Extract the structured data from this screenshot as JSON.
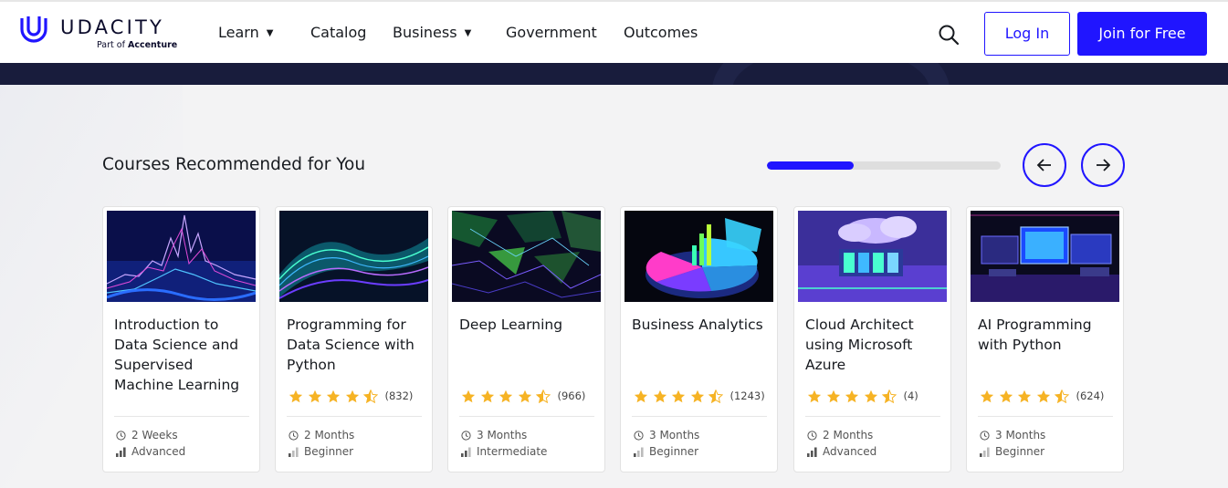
{
  "brand": {
    "name": "UDACITY",
    "subtitle_prefix": "Part of",
    "subtitle_company": "Accenture",
    "accent": "#2015ff"
  },
  "nav": {
    "items": [
      {
        "label": "Learn",
        "has_dropdown": true
      },
      {
        "label": "Catalog",
        "has_dropdown": false
      },
      {
        "label": "Business",
        "has_dropdown": true
      },
      {
        "label": "Government",
        "has_dropdown": false
      },
      {
        "label": "Outcomes",
        "has_dropdown": false
      }
    ],
    "search_icon": "search-icon",
    "login_label": "Log In",
    "join_label": "Join for Free"
  },
  "section": {
    "title": "Courses Recommended for You",
    "carousel_progress": 0.37,
    "prev_icon": "arrow-left-icon",
    "next_icon": "arrow-right-icon"
  },
  "cards": [
    {
      "title": "Introduction to Data Science and Supervised Machine Learning",
      "rating": null,
      "reviews": "",
      "duration": "2 Weeks",
      "level": "Advanced",
      "image": "data-peaks-image"
    },
    {
      "title": "Programming for Data Science with Python",
      "rating": 4.5,
      "reviews": "(832)",
      "duration": "2 Months",
      "level": "Beginner",
      "image": "data-wave-image"
    },
    {
      "title": "Deep Learning",
      "rating": 4.5,
      "reviews": "(966)",
      "duration": "3 Months",
      "level": "Intermediate",
      "image": "neural-mesh-image"
    },
    {
      "title": "Business Analytics",
      "rating": 4.5,
      "reviews": "(1243)",
      "duration": "3 Months",
      "level": "Beginner",
      "image": "pie-chart-image"
    },
    {
      "title": "Cloud Architect using Microsoft Azure",
      "rating": 4.5,
      "reviews": "(4)",
      "duration": "2 Months",
      "level": "Advanced",
      "image": "cloud-servers-image"
    },
    {
      "title": "AI Programming with Python",
      "rating": 4.5,
      "reviews": "(624)",
      "duration": "3 Months",
      "level": "Beginner",
      "image": "monitors-image"
    }
  ]
}
